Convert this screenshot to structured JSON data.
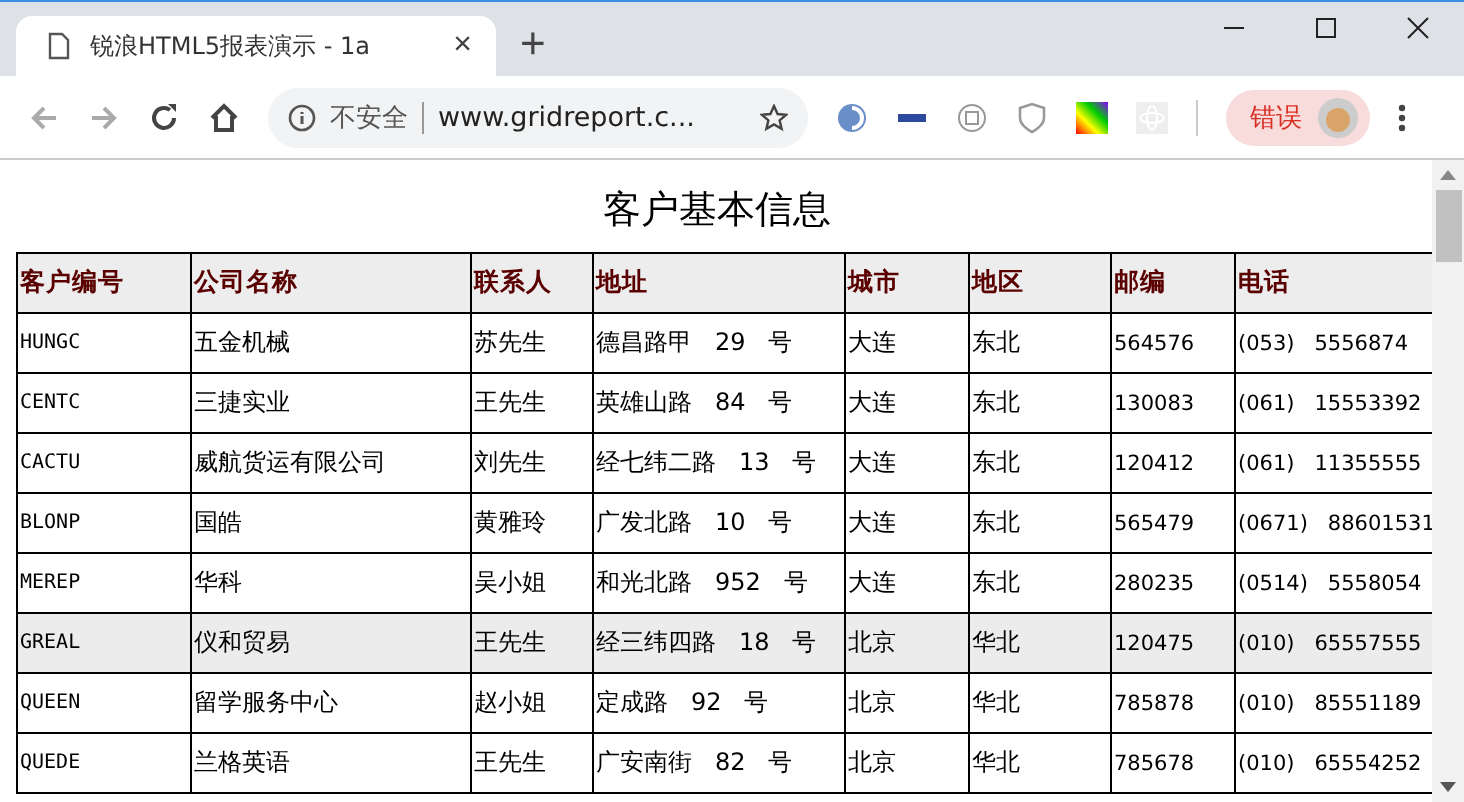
{
  "tab": {
    "title": "锐浪HTML5报表演示 - 1a",
    "close": "×",
    "new_tab": "+"
  },
  "address_bar": {
    "security": "不安全",
    "url": "www.gridreport.c..."
  },
  "profile": {
    "label": "错误"
  },
  "report": {
    "title": "客户基本信息",
    "columns": [
      "客户编号",
      "公司名称",
      "联系人",
      "地址",
      "城市",
      "地区",
      "邮编",
      "电话"
    ],
    "rows": [
      {
        "cells": [
          "HUNGC",
          "五金机械",
          "苏先生",
          "德昌路甲   29   号",
          "大连",
          "东北",
          "564576",
          "(053)   5556874"
        ],
        "selected": false
      },
      {
        "cells": [
          "CENTC",
          "三捷实业",
          "王先生",
          "英雄山路   84   号",
          "大连",
          "东北",
          "130083",
          "(061)   15553392"
        ],
        "selected": false
      },
      {
        "cells": [
          "CACTU",
          "威航货运有限公司",
          "刘先生",
          "经七纬二路   13   号",
          "大连",
          "东北",
          "120412",
          "(061)   11355555"
        ],
        "selected": false
      },
      {
        "cells": [
          "BLONP",
          "国皓",
          "黄雅玲",
          "广发北路   10   号",
          "大连",
          "东北",
          "565479",
          "(0671)   88601531"
        ],
        "selected": false
      },
      {
        "cells": [
          "MEREP",
          "华科",
          "吴小姐",
          "和光北路   952   号",
          "大连",
          "东北",
          "280235",
          "(0514)   5558054"
        ],
        "selected": false
      },
      {
        "cells": [
          "GREAL",
          "仪和贸易",
          "王先生",
          "经三纬四路   18   号",
          "北京",
          "华北",
          "120475",
          "(010)   65557555"
        ],
        "selected": true
      },
      {
        "cells": [
          "QUEEN",
          "留学服务中心",
          "赵小姐",
          "定成路   92   号",
          "北京",
          "华北",
          "785878",
          "(010)   85551189"
        ],
        "selected": false
      },
      {
        "cells": [
          "QUEDE",
          "兰格英语",
          "王先生",
          "广安南街   82   号",
          "北京",
          "华北",
          "785678",
          "(010)   65554252"
        ],
        "selected": false
      }
    ]
  }
}
